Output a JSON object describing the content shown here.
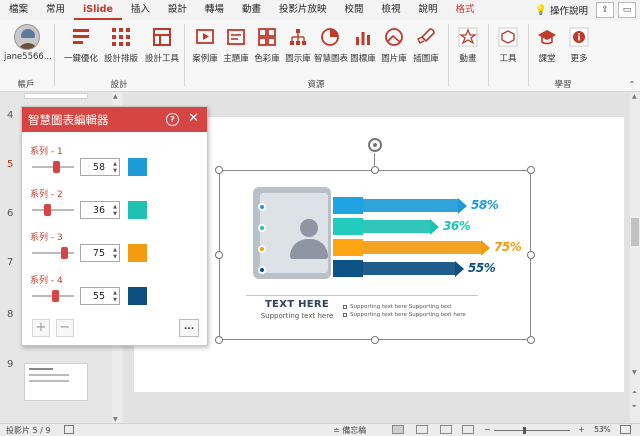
{
  "tabs": [
    "檔案",
    "常用",
    "iSlide",
    "插入",
    "設計",
    "轉場",
    "動畫",
    "投影片放映",
    "校閱",
    "檢視",
    "說明",
    "格式"
  ],
  "tab_active": "iSlide",
  "tab_search": "操作說明",
  "ribbon": {
    "account": {
      "user": "jane5566...",
      "group": "帳戶"
    },
    "design": {
      "group": "設計",
      "items": [
        "一鍵優化",
        "設計排版",
        "設計工具"
      ]
    },
    "resources": {
      "group": "資源",
      "items": [
        "案例庫",
        "主題庫",
        "色彩庫",
        "圖示庫",
        "智慧圖表",
        "圖標庫",
        "圖片庫",
        "插圖庫"
      ]
    },
    "animation": {
      "label": "動畫"
    },
    "tools": {
      "label": "工具"
    },
    "learning": {
      "group": "學習",
      "items": [
        "課堂",
        "更多"
      ]
    }
  },
  "thumbnails": {
    "numbers": [
      "4",
      "5",
      "6",
      "7",
      "8",
      "9"
    ],
    "active": "5"
  },
  "dialog": {
    "title": "智慧圖表編輯器",
    "series": [
      {
        "label": "系列 - 1",
        "value": "58",
        "level": 0.58,
        "color": "#1e9bd7"
      },
      {
        "label": "系列 - 2",
        "value": "36",
        "level": 0.36,
        "color": "#1fc1b4"
      },
      {
        "label": "系列 - 3",
        "value": "75",
        "level": 0.75,
        "color": "#f39c12"
      },
      {
        "label": "系列 - 4",
        "value": "55",
        "level": 0.55,
        "color": "#0d4f80"
      }
    ],
    "add": "+",
    "remove": "−",
    "more": "..."
  },
  "infographic": {
    "bars": [
      {
        "label": "58%",
        "value": 58,
        "color": "#1e9bd7"
      },
      {
        "label": "36%",
        "value": 36,
        "color": "#1fc1b4"
      },
      {
        "label": "75%",
        "value": 75,
        "color": "#f39c12"
      },
      {
        "label": "55%",
        "value": 55,
        "color": "#0d4f80"
      }
    ],
    "title": "TEXT HERE",
    "subtitle": "Supporting text here",
    "support_lines": [
      "Supporting text here Supporting text",
      "Supporting text here Supporting text here"
    ]
  },
  "status": {
    "slide": "投影片 5 / 9",
    "notes": "備忘稿",
    "zoom": "53%"
  }
}
